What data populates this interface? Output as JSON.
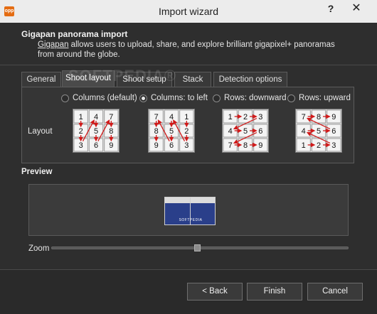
{
  "window": {
    "app_icon_text": "opp",
    "title": "Import wizard",
    "help_label": "?",
    "close_label": "✕"
  },
  "header": {
    "title": "Gigapan panorama import",
    "link_text": "Gigapan",
    "description": " allows users to upload, share, and explore brilliant gigapixel+ panoramas from around the globe."
  },
  "watermark": "SOFTPEDIA®",
  "tabs": [
    {
      "label": "General",
      "active": false
    },
    {
      "label": "Shoot layout",
      "active": true
    },
    {
      "label": "Shoot setup",
      "active": false
    },
    {
      "label": "Stack",
      "active": false
    },
    {
      "label": "Detection options",
      "active": false
    }
  ],
  "shoot_layout": {
    "layout_label": "Layout",
    "options": [
      {
        "label": "Columns (default)",
        "checked": false
      },
      {
        "label": "Columns: to left",
        "checked": true
      },
      {
        "label": "Rows: downward",
        "checked": false
      },
      {
        "label": "Rows: upward",
        "checked": false
      }
    ],
    "grids": [
      {
        "cells": [
          [
            1,
            4,
            7
          ],
          [
            2,
            5,
            8
          ],
          [
            3,
            6,
            9
          ]
        ]
      },
      {
        "cells": [
          [
            7,
            4,
            1
          ],
          [
            8,
            5,
            2
          ],
          [
            9,
            6,
            3
          ]
        ]
      },
      {
        "cells": [
          [
            1,
            2,
            3
          ],
          [
            4,
            5,
            6
          ],
          [
            7,
            8,
            9
          ]
        ]
      },
      {
        "cells": [
          [
            7,
            8,
            9
          ],
          [
            4,
            5,
            6
          ],
          [
            1,
            2,
            3
          ]
        ]
      }
    ]
  },
  "preview": {
    "label": "Preview",
    "thumbnail_watermark": "SOFTPEDIA",
    "zoom_label": "Zoom",
    "zoom_level": 0.49
  },
  "buttons": {
    "back": "< Back",
    "finish": "Finish",
    "cancel": "Cancel"
  },
  "colors": {
    "arrow": "#d11a1a",
    "cell_bg": "#f4f4f4",
    "panorama": "#2a3f8a"
  }
}
